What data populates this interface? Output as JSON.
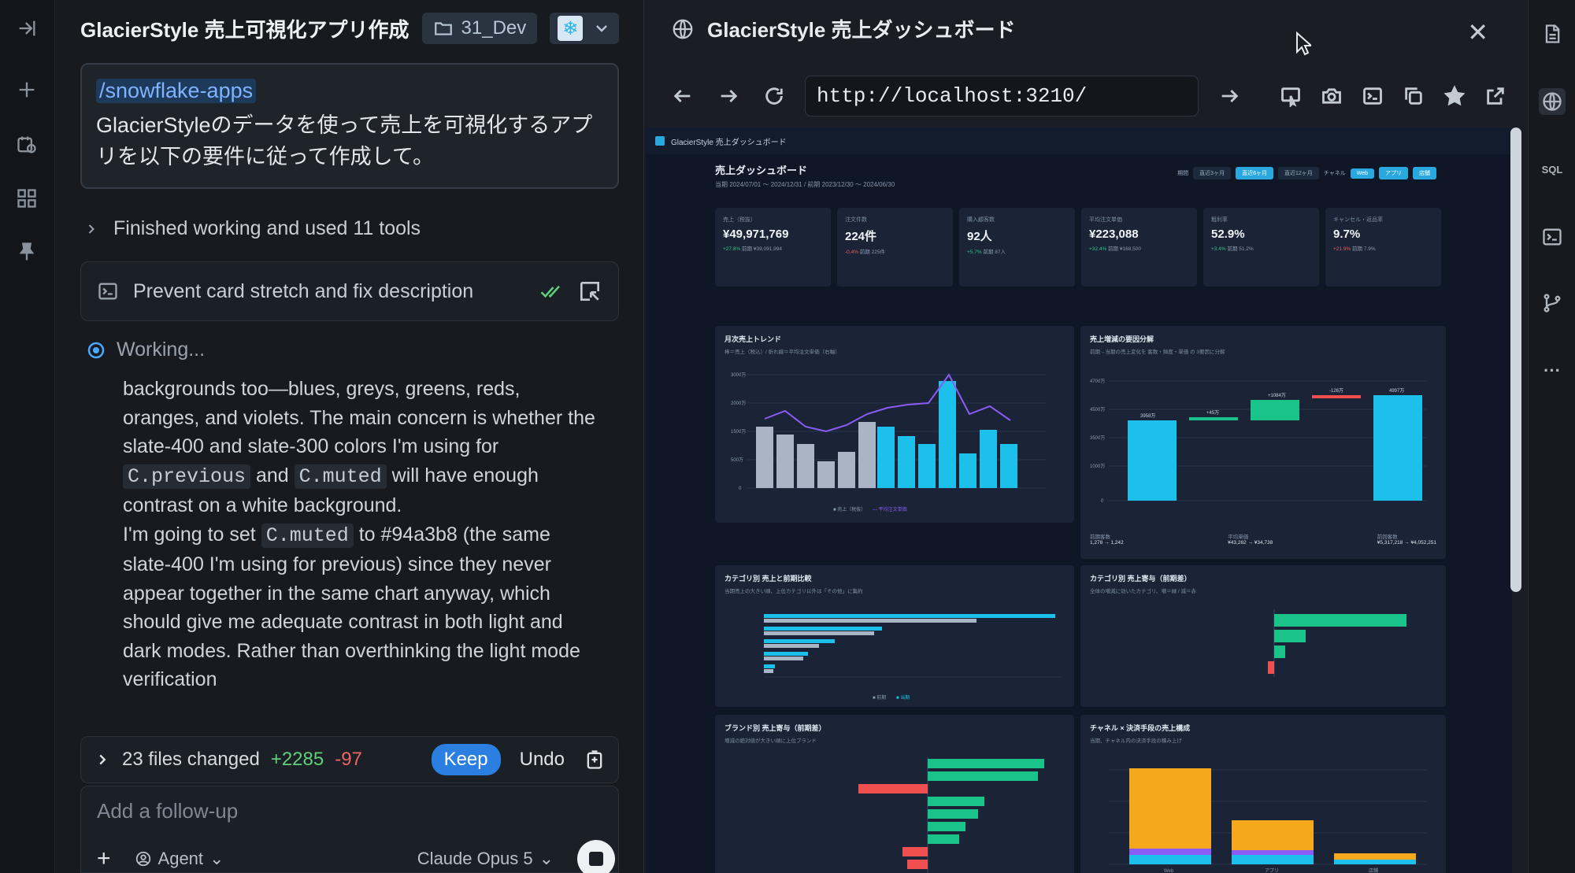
{
  "chat": {
    "title": "GlacierStyle 売上可視化アプリ作成",
    "repo": "31_Dev",
    "prompt": {
      "command": "/snowflake-apps",
      "text": "GlacierStyleのデータを使って売上を可視化するアプリを以下の要件に従って作成して。"
    },
    "tools_summary": "Finished working and used 11 tools",
    "task_label": "Prevent card stretch and fix description",
    "working_label": "Working...",
    "thinking": {
      "p1_a": "backgrounds too—blues, greys, greens, reds, oranges, and violets. The main concern is whether the slate-400 and slate-300 colors I'm using for",
      "code1": "C.previous",
      "and_text": "and",
      "code2": "C.muted",
      "p1_b": "will have enough contrast on a white background.",
      "p2_a": "I'm going to set",
      "code3": "C.muted",
      "p2_b": "to #94a3b8 (the same slate-400 I'm using for previous) since they never appear together in the same chart anyway, which should give me adequate contrast in both light and dark modes. Rather than overthinking the light mode verification"
    },
    "changes": {
      "summary": "23 files changed",
      "added": "+2285",
      "removed": "-97",
      "keep_label": "Keep",
      "undo_label": "Undo"
    },
    "followup": {
      "placeholder": "Add a follow-up",
      "mode": "Agent",
      "model": "Claude Opus 5"
    }
  },
  "browser": {
    "tab_title": "GlacierStyle 売上ダッシュボード",
    "url": "http://localhost:3210/"
  },
  "dashboard": {
    "app_bar": "GlacierStyle 売上ダッシュボード",
    "title": "売上ダッシュボード",
    "subtitle": "当期 2024/07/01 〜 2024/12/31 / 前期 2023/12/30 〜 2024/06/30",
    "filters": {
      "period_label": "期間",
      "periods": [
        "直近3ヶ月",
        "直近6ヶ月",
        "直近12ヶ月"
      ],
      "channel_label": "チャネル",
      "channels": [
        "Web",
        "アプリ",
        "店舗"
      ]
    },
    "kpis": [
      {
        "label": "売上（税抜）",
        "value": "¥49,971,769",
        "delta": "+27.8%",
        "note": "前期 ¥39,091,994"
      },
      {
        "label": "注文件数",
        "value": "224件",
        "delta": "-0.4%",
        "note": "前期 225件"
      },
      {
        "label": "購入顧客数",
        "value": "92人",
        "delta": "+5.7%",
        "note": "前期 87人"
      },
      {
        "label": "平均注文単価",
        "value": "¥223,088",
        "delta": "+32.4%",
        "note": "前期 ¥168,500"
      },
      {
        "label": "粗利率",
        "value": "52.9%",
        "delta": "+3.4%",
        "note": "前期 51.2%"
      },
      {
        "label": "キャンセル・返品率",
        "value": "9.7%",
        "delta": "+21.9%",
        "note": "前期 7.9%"
      }
    ],
    "cards": {
      "monthly_title": "月次売上トレンド",
      "monthly_sub": "棒＝売上（税込）/ 折れ線＝平均注文単価（右軸）",
      "waterfall_title": "売上増減の要因分解",
      "waterfall_sub": "前期→当期の売上変化を 客数・頻度・単価 の 3要因に分解",
      "category_title": "カテゴリ別 売上と前期比較",
      "category_sub": "当期売上の大きい順、上位カテゴリ以外は「その他」に集約",
      "category_contrib_title": "カテゴリ別 売上寄与（前期差）",
      "category_contrib_sub": "全体の増減に効いたカテゴリ、増＝緑 / 減＝赤",
      "brand_title": "ブランド別 売上寄与（前期差）",
      "brand_sub": "増減の絶対値が大きい順に上位ブランド",
      "channel_title": "チャネル × 決済手段の売上構成",
      "channel_sub": "当期、チャネル内の決済手段の積み上げ"
    },
    "waterfall_footer": [
      {
        "label": "前期客数",
        "value": "1,278 → 1,242"
      },
      {
        "label": "平均単価",
        "value": "¥43,262 → ¥34,738"
      },
      {
        "label": "前回客数",
        "value": "¥5,317,218 → ¥4,052,251"
      }
    ]
  },
  "colors": {
    "accent": "#2b7fe0",
    "bar_cyan": "#1cc0ea",
    "bar_grey": "#a9b4c4",
    "line_violet": "#8b5cf6",
    "pos": "#19c38a",
    "neg": "#ef4f4f",
    "amber": "#f5a81c"
  },
  "icons": {
    "left_rail": [
      "collapse-icon",
      "plus-icon",
      "history-icon",
      "grid-icon",
      "pin-icon"
    ],
    "right_rail": [
      "document-icon",
      "globe-icon",
      "sql-icon",
      "terminal-icon",
      "git-branch-icon",
      "more-icon"
    ]
  }
}
